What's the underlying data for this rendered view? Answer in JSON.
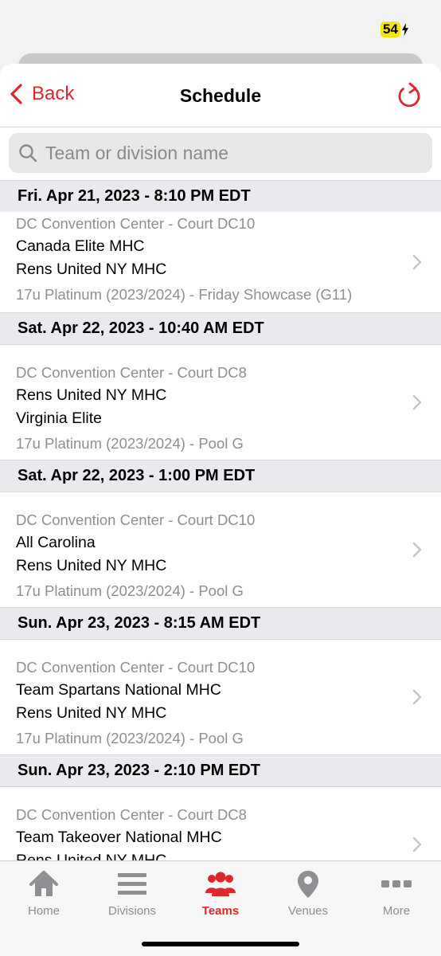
{
  "status": {
    "battery": "54"
  },
  "nav": {
    "back_label": "Back",
    "title": "Schedule"
  },
  "search": {
    "placeholder": "Team or division name",
    "value": ""
  },
  "games": [
    {
      "header": "Fri. Apr 21, 2023 - 8:10 PM EDT",
      "venue": "DC Convention Center - Court DC10",
      "team1": "Canada Elite MHC",
      "team2": "Rens United NY MHC",
      "division": "17u Platinum (2023/2024) - Friday Showcase (G11)"
    },
    {
      "header": "Sat. Apr 22, 2023 - 10:40 AM EDT",
      "venue": "DC Convention Center - Court DC8",
      "team1": "Rens United NY MHC",
      "team2": "Virginia Elite",
      "division": "17u Platinum (2023/2024) - Pool G"
    },
    {
      "header": "Sat. Apr 22, 2023 - 1:00 PM EDT",
      "venue": "DC Convention Center - Court DC10",
      "team1": "All Carolina",
      "team2": "Rens United NY MHC",
      "division": "17u Platinum (2023/2024) - Pool G"
    },
    {
      "header": "Sun. Apr 23, 2023 - 8:15 AM EDT",
      "venue": "DC Convention Center - Court DC10",
      "team1": "Team Spartans National MHC",
      "team2": "Rens United NY MHC",
      "division": "17u Platinum (2023/2024) - Pool G"
    },
    {
      "header": "Sun. Apr 23, 2023 - 2:10 PM EDT",
      "venue": "DC Convention Center - Court DC8",
      "team1": "Team Takeover National MHC",
      "team2": "Rens United NY MHC",
      "division": ""
    }
  ],
  "tabs": [
    {
      "label": "Home",
      "icon": "home-icon",
      "active": false
    },
    {
      "label": "Divisions",
      "icon": "list-icon",
      "active": false
    },
    {
      "label": "Teams",
      "icon": "people-icon",
      "active": true
    },
    {
      "label": "Venues",
      "icon": "location-pin-icon",
      "active": false
    },
    {
      "label": "More",
      "icon": "more-dots-icon",
      "active": false
    }
  ],
  "colors": {
    "accent": "#e0262d",
    "header_bg": "#e9e9ee",
    "inactive": "#8e8e93"
  }
}
